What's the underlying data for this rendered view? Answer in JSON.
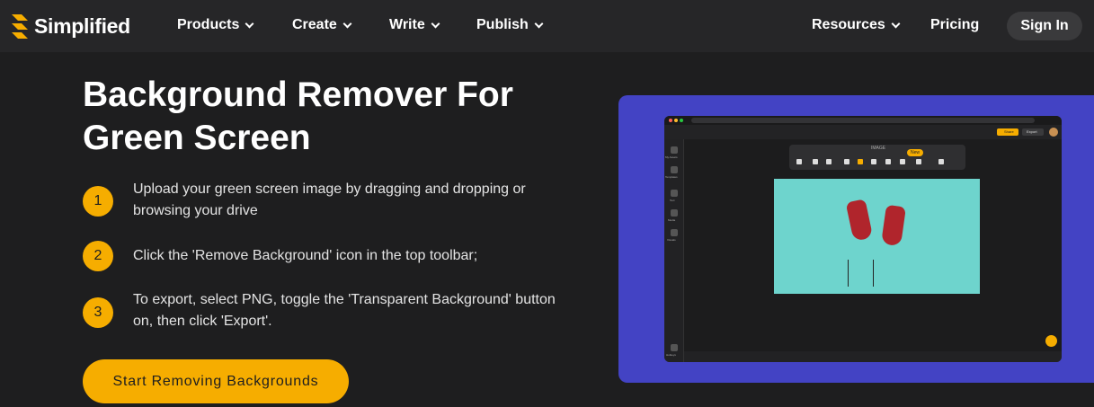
{
  "nav": {
    "logo_text": "Simplified",
    "items": [
      {
        "label": "Products"
      },
      {
        "label": "Create"
      },
      {
        "label": "Write"
      },
      {
        "label": "Publish"
      },
      {
        "label": "Resources"
      },
      {
        "label": "Pricing"
      }
    ],
    "signin_label": "Sign In"
  },
  "hero": {
    "title_line1": "Background Remover For",
    "title_line2": "Green Screen",
    "steps": [
      {
        "num": "1",
        "line1": "Upload your green screen image by dragging and dropping or",
        "line2": "browsing your drive"
      },
      {
        "num": "2",
        "line1": "Click the 'Remove Background' icon in the top toolbar;",
        "line2": ""
      },
      {
        "num": "3",
        "line1": "To export, select PNG, toggle the 'Transparent Background' button",
        "line2": "on, then click 'Export'."
      }
    ],
    "cta_label": "Start Removing Backgrounds"
  },
  "preview": {
    "toolbar_label": "IMAGE",
    "new_badge": "New",
    "share_label": "Share",
    "export_label": "Export",
    "sidebar_labels": [
      "My Assets",
      "Templates",
      "Text",
      "Media",
      "Visuals",
      "Hotkeys"
    ]
  },
  "colors": {
    "accent": "#f6ad00",
    "background": "#1e1e1f",
    "nav": "#262628",
    "preview_bg": "#4343c4"
  }
}
